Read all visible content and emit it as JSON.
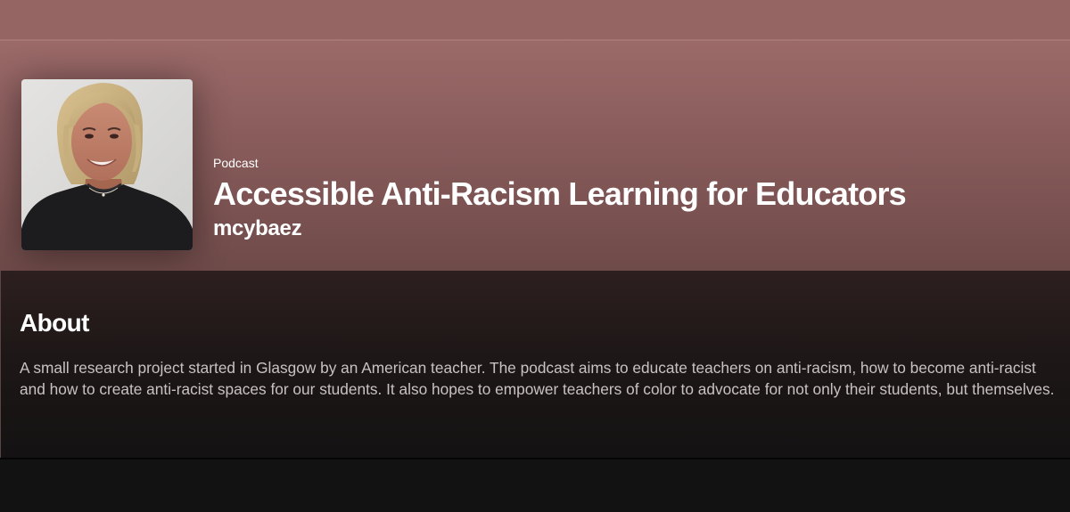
{
  "show": {
    "type_label": "Podcast",
    "title": "Accessible Anti-Racism Learning for Educators",
    "author": "mcybaez"
  },
  "about": {
    "heading": "About",
    "description": "A small research project started in Glasgow by an American teacher. The podcast aims to educate teachers on anti-racism, how to become anti-racist and how to create anti-racist spaces for our students. It also hopes to empower teachers of color to advocate for not only their students, but themselves."
  },
  "colors": {
    "header_background": "#956564",
    "content_background": "#2d1f1f",
    "page_background": "#121212",
    "text_primary": "#ffffff",
    "text_secondary": "#c9c2c2"
  }
}
